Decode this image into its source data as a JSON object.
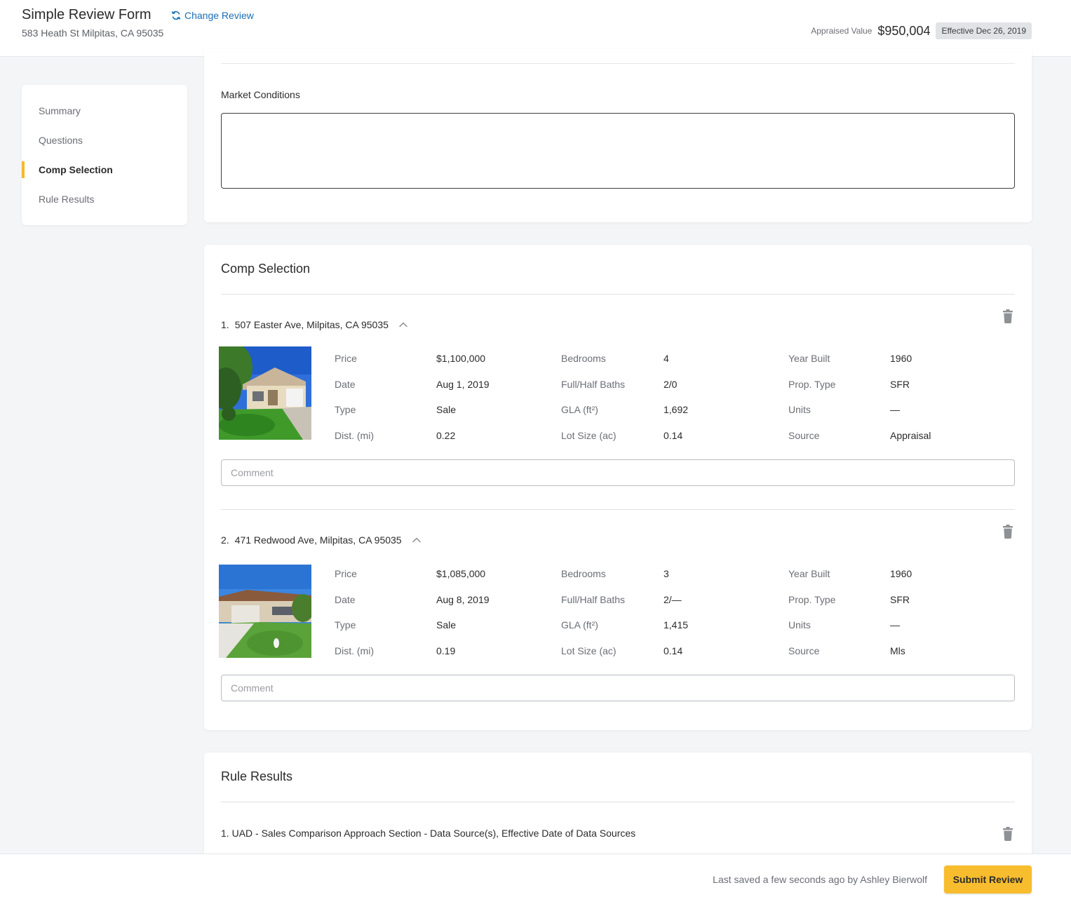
{
  "header": {
    "title": "Simple Review Form",
    "change_review_label": "Change Review",
    "address": "583 Heath St Milpitas, CA 95035",
    "appraised_label": "Appraised Value",
    "appraised_value": "$950,004",
    "effective_badge": "Effective Dec 26, 2019"
  },
  "sidebar": {
    "items": [
      {
        "label": "Summary",
        "active": false
      },
      {
        "label": "Questions",
        "active": false
      },
      {
        "label": "Comp Selection",
        "active": true
      },
      {
        "label": "Rule Results",
        "active": false
      }
    ]
  },
  "market_conditions": {
    "label": "Market Conditions",
    "value": ""
  },
  "comp_selection": {
    "title": "Comp Selection",
    "comment_placeholder": "Comment",
    "field_labels": {
      "price": "Price",
      "date": "Date",
      "type": "Type",
      "dist": "Dist. (mi)",
      "bedrooms": "Bedrooms",
      "baths": "Full/Half Baths",
      "gla": "GLA (ft²)",
      "lot": "Lot Size (ac)",
      "year_built": "Year Built",
      "prop_type": "Prop. Type",
      "units": "Units",
      "source": "Source"
    },
    "comps": [
      {
        "number": "1.",
        "address": "507 Easter Ave, Milpitas, CA 95035",
        "price": "$1,100,000",
        "date": "Aug 1, 2019",
        "type": "Sale",
        "dist": "0.22",
        "bedrooms": "4",
        "baths": "2/0",
        "gla": "1,692",
        "lot": "0.14",
        "year_built": "1960",
        "prop_type": "SFR",
        "units": "—",
        "source": "Appraisal",
        "comment": ""
      },
      {
        "number": "2.",
        "address": "471 Redwood Ave, Milpitas, CA 95035",
        "price": "$1,085,000",
        "date": "Aug 8, 2019",
        "type": "Sale",
        "dist": "0.19",
        "bedrooms": "3",
        "baths": "2/—",
        "gla": "1,415",
        "lot": "0.14",
        "year_built": "1960",
        "prop_type": "SFR",
        "units": "—",
        "source": "Mls",
        "comment": ""
      }
    ]
  },
  "rule_results": {
    "title": "Rule Results",
    "items": [
      {
        "number": "1.",
        "label": "UAD - Sales Comparison Approach Section - Data Source(s), Effective Date of Data Sources"
      }
    ]
  },
  "footer": {
    "saved_text": "Last saved a few seconds ago by Ashley Bierwolf",
    "submit_label": "Submit Review"
  },
  "colors": {
    "accent": "#f8bd2e",
    "link": "#1a6fb5",
    "background": "#f4f5f7"
  }
}
